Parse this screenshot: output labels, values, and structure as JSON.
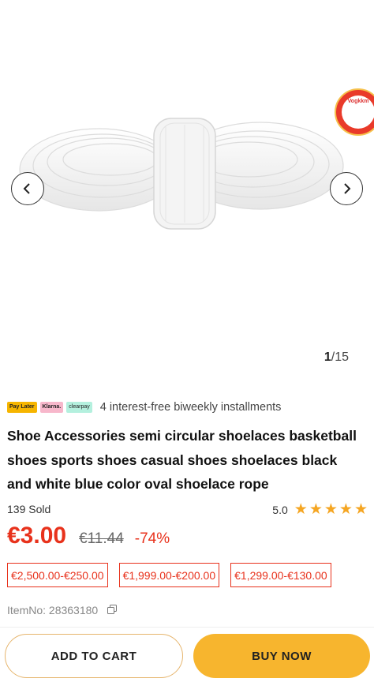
{
  "gallery": {
    "current": "1",
    "total": "/15",
    "badge_text": "Vogkkm"
  },
  "payment": {
    "logos": [
      "Pay Later",
      "Klarna.",
      "clearpay"
    ],
    "text": "4 interest-free biweekly installments"
  },
  "product": {
    "title": "Shoe Accessories semi circular shoelaces basketball shoes sports shoes casual shoes shoelaces black and white blue color oval shoelace rope",
    "sold": "139 Sold",
    "rating": "5.0",
    "stars": 5,
    "price": "€3.00",
    "original_price": "€11.44",
    "discount": "-74%",
    "item_no": "ItemNo: 28363180"
  },
  "coupons": [
    "€2,500.00-€250.00",
    "€1,999.00-€200.00",
    "€1,299.00-€130.00"
  ],
  "actions": {
    "add_to_cart": "ADD TO CART",
    "buy_now": "BUY NOW"
  },
  "colors": {
    "accent_red": "#e8321c",
    "buy_yellow": "#f7b52e",
    "star": "#f5a623"
  }
}
